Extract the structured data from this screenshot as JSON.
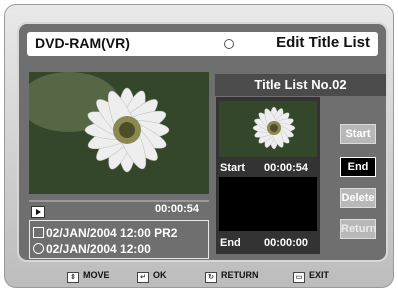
{
  "header": {
    "disc": "DVD-RAM(VR)",
    "menu_title": "Edit Title List"
  },
  "preview": {
    "timestamp": "00:00:54",
    "info_line_1": "02/JAN/2004 12:00 PR2",
    "info_line_2": "02/JAN/2004 12:00"
  },
  "panel": {
    "title": "Title List No.02",
    "start_label": "Start",
    "start_time": "00:00:54",
    "end_label": "End",
    "end_time": "00:00:00"
  },
  "buttons": {
    "start": "Start",
    "end": "End",
    "delete": "Delete",
    "return": "Return"
  },
  "footer": {
    "move": "MOVE",
    "ok": "OK",
    "return": "RETURN",
    "exit": "EXIT"
  }
}
